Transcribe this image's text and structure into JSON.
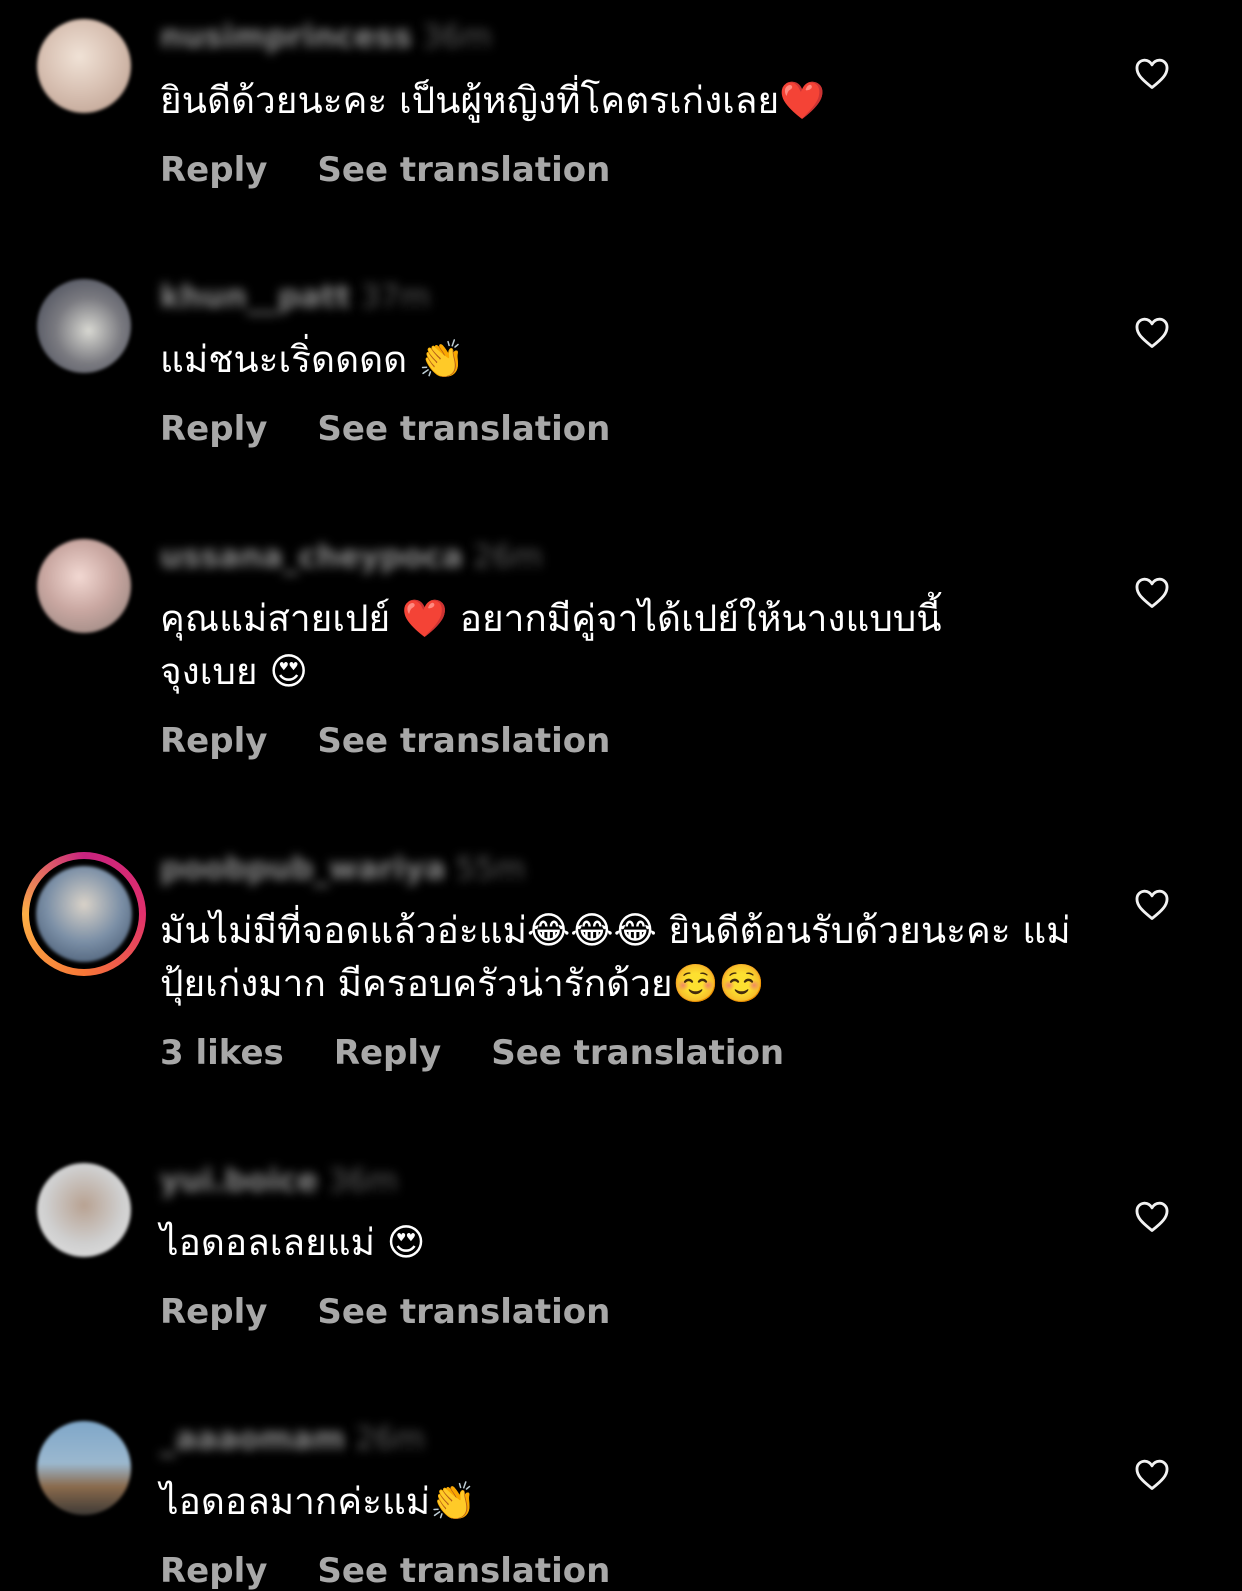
{
  "comments": [
    {
      "username": "nusimprincess",
      "time": "36m",
      "text": "ยินดีด้วยนะคะ เป็นผู้หญิงที่โคตรเก่งเลย❤️",
      "likes": "",
      "reply_label": "Reply",
      "translate_label": "See translation",
      "avatar_color": "#d9c2b4"
    },
    {
      "username": "khun__patt",
      "time": "37m",
      "text": "แม่ชนะเริ่ดดดด 👏",
      "likes": "",
      "reply_label": "Reply",
      "translate_label": "See translation",
      "avatar_color": "#5b5f6a"
    },
    {
      "username": "ussana_cheypoca",
      "time": "26m",
      "text": "คุณแม่สายเปย์ ❤️ อยากมีคู่จาได้เปย์ให้นางแบบนี้ จุงเบย 😍",
      "likes": "",
      "reply_label": "Reply",
      "translate_label": "See translation",
      "avatar_color": "#c9a7a1"
    },
    {
      "username": "poobpub_wariya",
      "time": "55m",
      "text": "มันไม่มีที่จอดแล้วอ่ะแม่😂😂😂 ยินดีต้อนรับด้วยนะคะ แม่ปุ้ยเก่งมาก มีครอบครัวน่ารักด้วย☺️☺️",
      "likes": "3 likes",
      "reply_label": "Reply",
      "translate_label": "See translation",
      "avatar_color": "#7b8fa6"
    },
    {
      "username": "yui.boice",
      "time": "36m",
      "text": "ไอดอลเลยแม่ 😍",
      "likes": "",
      "reply_label": "Reply",
      "translate_label": "See translation",
      "avatar_color": "#cfcfcf"
    },
    {
      "username": "_aaaomam",
      "time": "26m",
      "text": "ไอดอลมากค่ะแม่👏",
      "likes": "",
      "reply_label": "Reply",
      "translate_label": "See translation",
      "avatar_color": "#6e8aa3"
    }
  ]
}
